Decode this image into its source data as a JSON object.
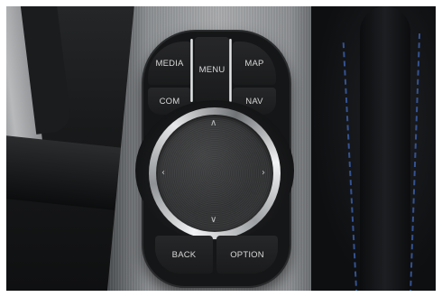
{
  "controller": {
    "buttons": {
      "media": "MEDIA",
      "menu": "MENU",
      "map": "MAP",
      "com": "COM",
      "nav": "NAV",
      "back": "BACK",
      "option": "OPTION"
    },
    "knob_icons": {
      "up": "chevron-up-icon",
      "down": "chevron-down-icon",
      "left": "chevron-left-icon",
      "right": "chevron-right-icon"
    }
  },
  "colors": {
    "stitching": "#3b5ea8",
    "button_text": "#d8d8d8",
    "chrome": "#d9dadb"
  }
}
